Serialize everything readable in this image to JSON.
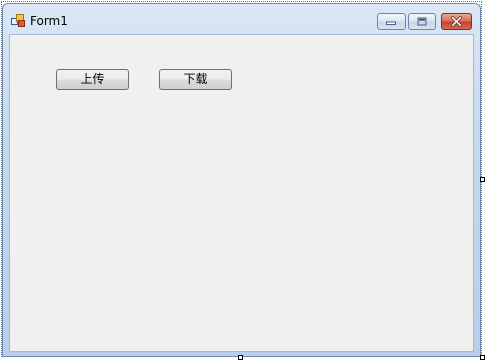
{
  "window": {
    "title": "Form1",
    "controls": {
      "minimize_icon": "minimize-icon",
      "maximize_icon": "maximize-icon",
      "close_icon": "close-icon"
    },
    "colors": {
      "frame": "#c5d8ee",
      "client": "#f0f0f0",
      "close_button": "#c6432b"
    }
  },
  "form": {
    "buttons": {
      "upload_label": "上传",
      "download_label": "下载"
    }
  }
}
